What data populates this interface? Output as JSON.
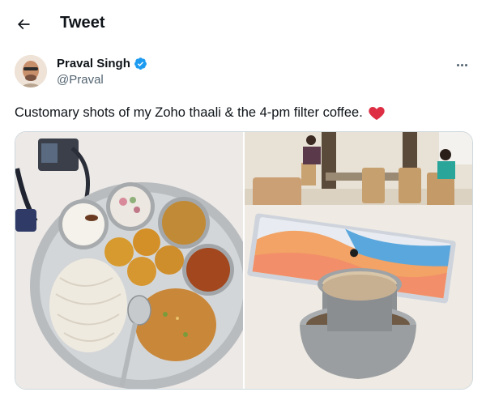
{
  "header": {
    "title": "Tweet",
    "back_icon": "arrow-left-icon"
  },
  "author": {
    "name": "Praval Singh",
    "handle": "@Praval",
    "verified": true,
    "verified_color": "#1d9bf0"
  },
  "tweet": {
    "text": "Customary shots of my Zoho thaali & the 4-pm filter coffee.",
    "emoji_icon": "red-heart-icon"
  },
  "media": {
    "images": [
      "thaali-photo",
      "filter-coffee-photo"
    ]
  },
  "colors": {
    "accent": "#1d9bf0",
    "heart": "#e0245e",
    "secondary_text": "#536471"
  }
}
